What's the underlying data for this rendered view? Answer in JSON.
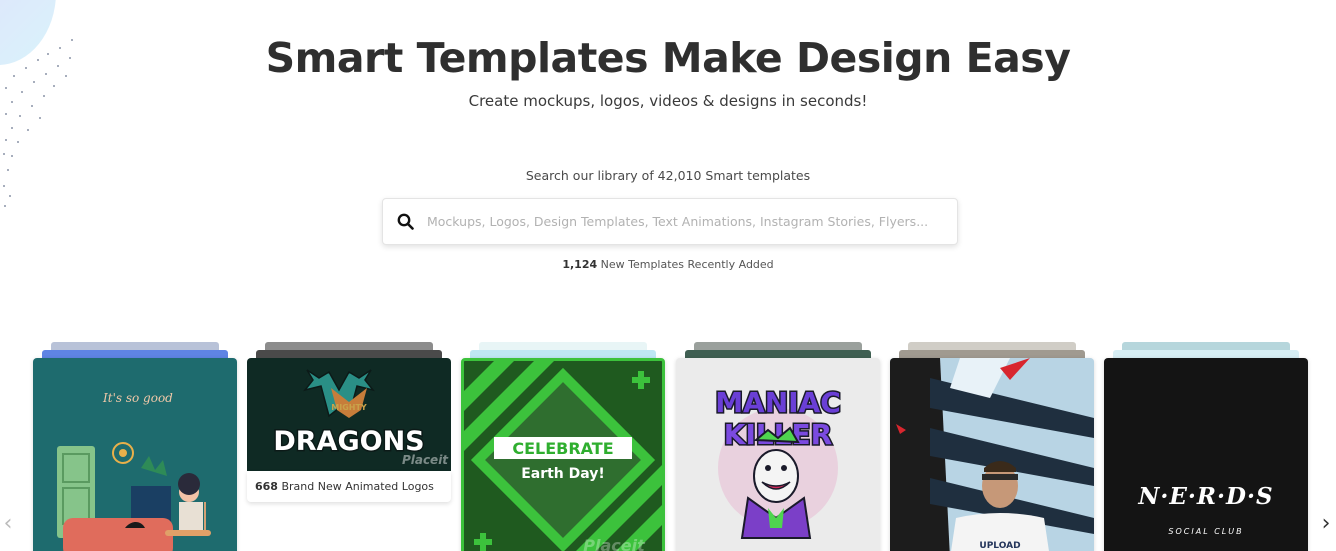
{
  "hero": {
    "title": "Smart Templates Make Design Easy",
    "subtitle": "Create mockups, logos, videos & designs in seconds!"
  },
  "search": {
    "library_text": "Search our library of 42,010 Smart templates",
    "placeholder": "Mockups, Logos, Design Templates, Text Animations, Instagram Stories, Flyers...",
    "new_count": "1,124",
    "new_label": "New Templates Recently Added"
  },
  "cards": [
    {
      "name": "illustration-card",
      "icon": "illustration",
      "script_text": "It's so good"
    },
    {
      "name": "animated-logos-card",
      "icon": "dragon-logo",
      "logo_top": "MIGHTY",
      "logo_main": "DRAGONS",
      "watermark": "Placeit",
      "caption_count": "668",
      "caption_label": "Brand New Animated Logos"
    },
    {
      "name": "earth-day-card",
      "icon": "banner",
      "banner_top": "CELEBRATE",
      "banner_bottom": "Earth Day!",
      "watermark": "Placeit"
    },
    {
      "name": "maniac-killer-card",
      "icon": "joker-logo",
      "logo_line1": "MANIAC",
      "logo_line2": "KILLER"
    },
    {
      "name": "tshirt-mockup-card",
      "icon": "photo-mockup",
      "shirt_text": "UPLOAD"
    },
    {
      "name": "nerds-card",
      "icon": "text-logo",
      "logo_main": "N·E·R·D·S",
      "logo_sub": "SOCIAL CLUB"
    }
  ],
  "nav": {
    "prev": "‹",
    "next": "›"
  },
  "colors": {
    "teal": "#1e6b6e",
    "green": "#3cc23c",
    "dark": "#141414",
    "accent": "#2b2b2b"
  }
}
